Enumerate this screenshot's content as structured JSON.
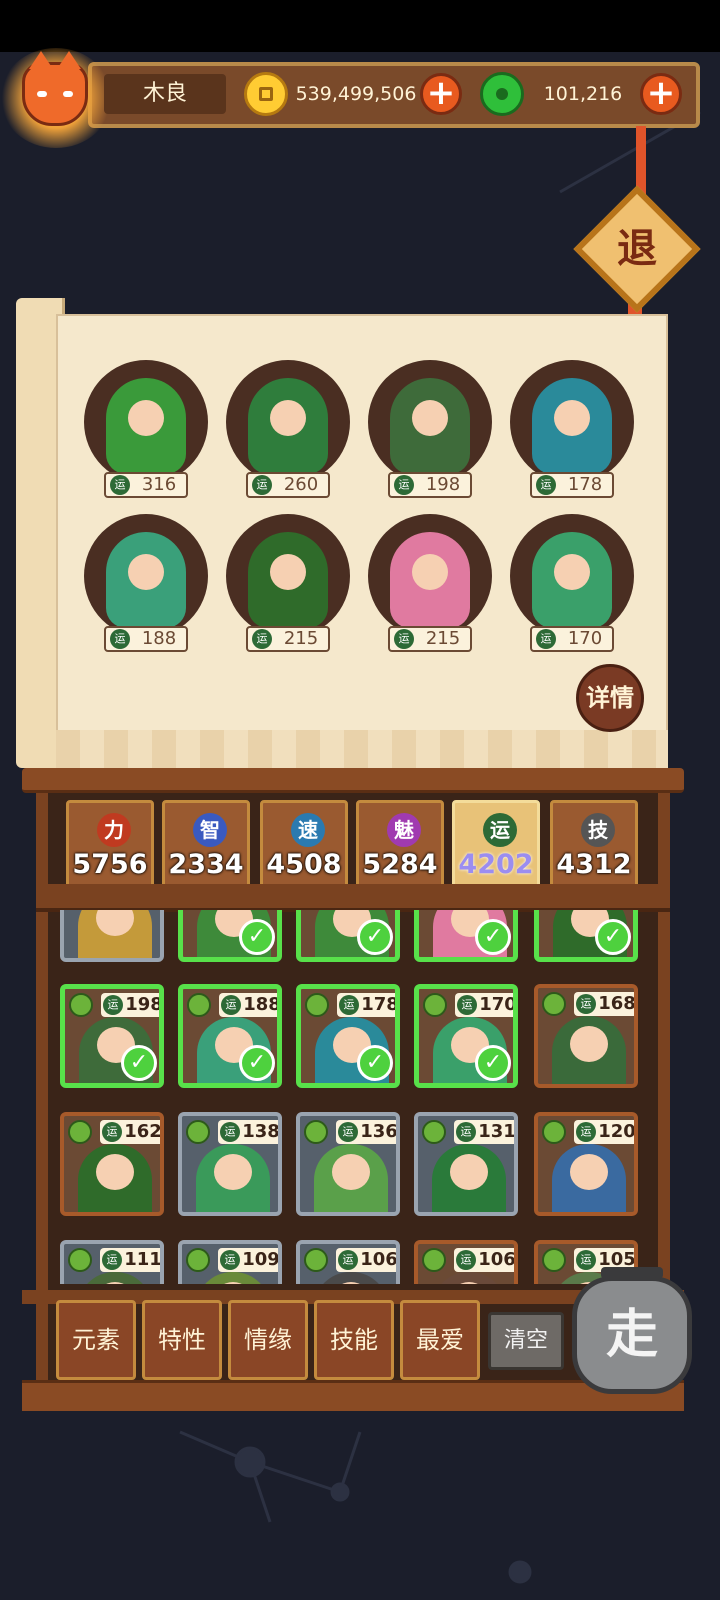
{
  "player": {
    "name": "木良"
  },
  "currency": {
    "gold": {
      "icon": "gold-coin-icon",
      "value": "539,499,506",
      "color": "#ffcc33"
    },
    "jade": {
      "icon": "jade-coin-icon",
      "value": "101,216",
      "color": "#2fbf3a"
    },
    "plus_label": "+"
  },
  "exit_label": "退",
  "details_label": "详情",
  "stat_label": "运",
  "selected_heroes": [
    {
      "value": "316",
      "color": "#3a9a3a"
    },
    {
      "value": "260",
      "color": "#2f7d3c"
    },
    {
      "value": "198",
      "color": "#3e6b3a"
    },
    {
      "value": "178",
      "color": "#2a8a9a"
    },
    {
      "value": "188",
      "color": "#3aa07a"
    },
    {
      "value": "215",
      "color": "#2f6b2a"
    },
    {
      "value": "215",
      "color": "#e07aa0"
    },
    {
      "value": "170",
      "color": "#3aa06a"
    }
  ],
  "stats": [
    {
      "label": "力",
      "value": "5756",
      "color": "#c03a20"
    },
    {
      "label": "智",
      "value": "2334",
      "color": "#3a5ac0"
    },
    {
      "label": "速",
      "value": "4508",
      "color": "#2a7ab0"
    },
    {
      "label": "魅",
      "value": "5284",
      "color": "#a03ab0"
    },
    {
      "label": "运",
      "value": "4202",
      "color": "#2d6a36",
      "active": true
    },
    {
      "label": "技",
      "value": "4312",
      "color": "#555555"
    }
  ],
  "roster_top_partial": [
    {
      "selected": false,
      "silver": true,
      "color": "#c49a3a"
    },
    {
      "selected": true,
      "silver": false,
      "color": "#3e8a3a"
    },
    {
      "selected": true,
      "silver": false,
      "color": "#3e8a3a"
    },
    {
      "selected": true,
      "silver": false,
      "color": "#e07aa0"
    },
    {
      "selected": true,
      "silver": false,
      "color": "#2f6b2a"
    }
  ],
  "roster": [
    {
      "value": "198",
      "selected": true,
      "silver": false,
      "color": "#3e6b3a"
    },
    {
      "value": "188",
      "selected": true,
      "silver": false,
      "color": "#3aa07a"
    },
    {
      "value": "178",
      "selected": true,
      "silver": false,
      "color": "#2a8a9a"
    },
    {
      "value": "170",
      "selected": true,
      "silver": false,
      "color": "#3aa06a"
    },
    {
      "value": "168",
      "selected": false,
      "silver": false,
      "color": "#3a6a3a"
    },
    {
      "value": "162",
      "selected": false,
      "silver": false,
      "color": "#2f6b2a"
    },
    {
      "value": "138",
      "selected": false,
      "silver": true,
      "color": "#3a9a5a"
    },
    {
      "value": "136",
      "selected": false,
      "silver": true,
      "color": "#5aa04a"
    },
    {
      "value": "131",
      "selected": false,
      "silver": true,
      "color": "#2a7a3a"
    },
    {
      "value": "120",
      "selected": false,
      "silver": false,
      "color": "#3a6aa0"
    },
    {
      "value": "111",
      "selected": false,
      "silver": true,
      "color": "#4a6a3a"
    },
    {
      "value": "109",
      "selected": false,
      "silver": true,
      "color": "#6a8a3a"
    },
    {
      "value": "106",
      "selected": false,
      "silver": true,
      "color": "#4a4a4a"
    },
    {
      "value": "106",
      "selected": false,
      "silver": false,
      "color": "#6a4a3a"
    },
    {
      "value": "105",
      "selected": false,
      "silver": false,
      "color": "#5a7a4a"
    }
  ],
  "filters": [
    "元素",
    "特性",
    "情缘",
    "技能",
    "最爱"
  ],
  "clear_label": "清空",
  "go_label": "走"
}
